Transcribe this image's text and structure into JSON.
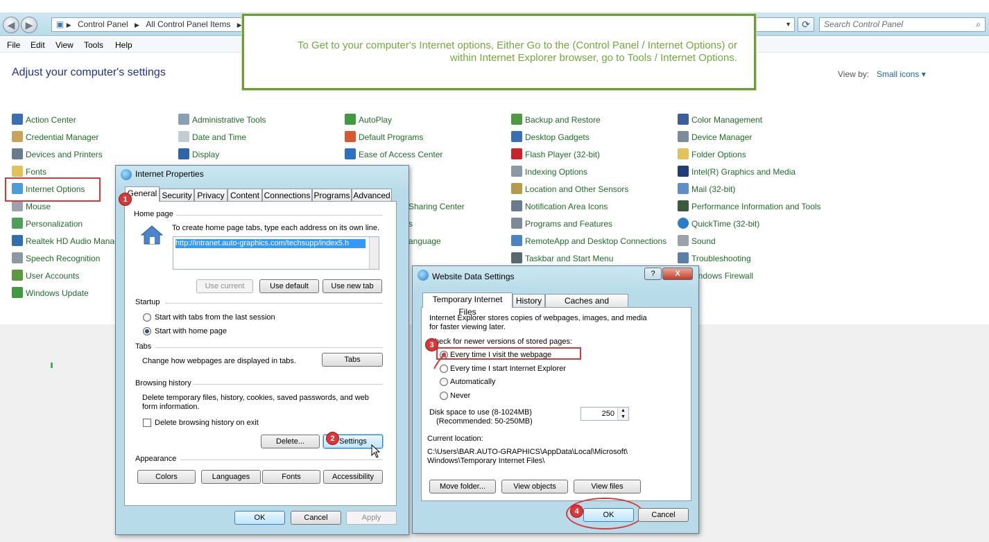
{
  "colors": {
    "link": "#1f6b2a",
    "title": "#1e3287",
    "callout": "#74a83b",
    "annotation": "#d9383b"
  },
  "address_bar": {
    "crumbs": [
      "Control Panel",
      "All Control Panel Items"
    ],
    "search_placeholder": "Search Control Panel",
    "refresh_icon": "refresh-icon",
    "search_icon": "magnifier-icon"
  },
  "menu": [
    "File",
    "Edit",
    "View",
    "Tools",
    "Help"
  ],
  "page": {
    "title": "Adjust your computer's settings",
    "view_by_label": "View by:",
    "view_by_value": "Small icons"
  },
  "callout": {
    "line1": "To Get to your computer's Internet options, Either Go to the (Control Panel / Internet Options)  or",
    "line2": "within Internet Explorer browser, go to Tools / Internet Options."
  },
  "cp_items": {
    "col1": [
      "Action Center",
      "Credential Manager",
      "Devices and Printers",
      "Fonts",
      "Internet Options",
      "Mouse",
      "Personalization",
      "Realtek HD Audio Manag",
      "Speech Recognition",
      "User Accounts",
      "Windows Update"
    ],
    "col2": [
      "Administrative Tools",
      "Date and Time",
      "Display"
    ],
    "col3": [
      "AutoPlay",
      "Default Programs",
      "Ease of Access Center"
    ],
    "col3_partial": [
      "Sharing Center",
      "s",
      "anguage"
    ],
    "col4": [
      "Backup and Restore",
      "Desktop Gadgets",
      "Flash Player (32-bit)",
      "Indexing Options",
      "Location and Other Sensors",
      "Notification Area Icons",
      "Programs and Features",
      "RemoteApp and Desktop Connections",
      "Taskbar and Start Menu"
    ],
    "col5": [
      "Color Management",
      "Device Manager",
      "Folder Options",
      "Intel(R) Graphics and Media",
      "Mail (32-bit)",
      "Performance Information and Tools",
      "QuickTime (32-bit)",
      "Sound",
      "Troubleshooting",
      "indows Firewall"
    ]
  },
  "internet_properties": {
    "title": "Internet Properties",
    "tabs": [
      "General",
      "Security",
      "Privacy",
      "Content",
      "Connections",
      "Programs",
      "Advanced"
    ],
    "home_page": {
      "heading": "Home page",
      "hint": "To create home page tabs, type each address on its own line.",
      "url": "http://intranet.auto-graphics.com/techsupp/index5.h",
      "use_current": "Use current",
      "use_default": "Use default",
      "use_new_tab": "Use new tab"
    },
    "startup": {
      "heading": "Startup",
      "opt1": "Start with tabs from the last session",
      "opt2": "Start with home page"
    },
    "tabs_group": {
      "heading": "Tabs",
      "text": "Change how webpages are displayed in tabs.",
      "button": "Tabs"
    },
    "history": {
      "heading": "Browsing history",
      "text1": "Delete temporary files, history, cookies, saved passwords, and web",
      "text2": "form information.",
      "checkbox": "Delete browsing history on exit",
      "delete": "Delete...",
      "settings": "Settings"
    },
    "appearance": {
      "heading": "Appearance",
      "colors": "Colors",
      "languages": "Languages",
      "fonts": "Fonts",
      "accessibility": "Accessibility"
    },
    "ok": "OK",
    "cancel": "Cancel",
    "apply": "Apply"
  },
  "website_data": {
    "title": "Website Data Settings",
    "help": "?",
    "close": "X",
    "tabs": [
      "Temporary Internet Files",
      "History",
      "Caches and databases"
    ],
    "desc1": "Internet Explorer stores copies of webpages, images, and media",
    "desc2": "for faster viewing later.",
    "check_label": "Check for newer versions of stored pages:",
    "options": [
      "Every time I visit the webpage",
      "Every time I start Internet Explorer",
      "Automatically",
      "Never"
    ],
    "disk_label1": "Disk space to use (8-1024MB)",
    "disk_label2": "(Recommended: 50-250MB)",
    "disk_value": "250",
    "location_label": "Current location:",
    "location_path1": "C:\\Users\\BAR.AUTO-GRAPHICS\\AppData\\Local\\Microsoft\\",
    "location_path2": "Windows\\Temporary Internet Files\\",
    "move_folder": "Move folder...",
    "view_objects": "View objects",
    "view_files": "View files",
    "ok": "OK",
    "cancel": "Cancel"
  },
  "steps": [
    "1",
    "2",
    "3",
    "4"
  ]
}
